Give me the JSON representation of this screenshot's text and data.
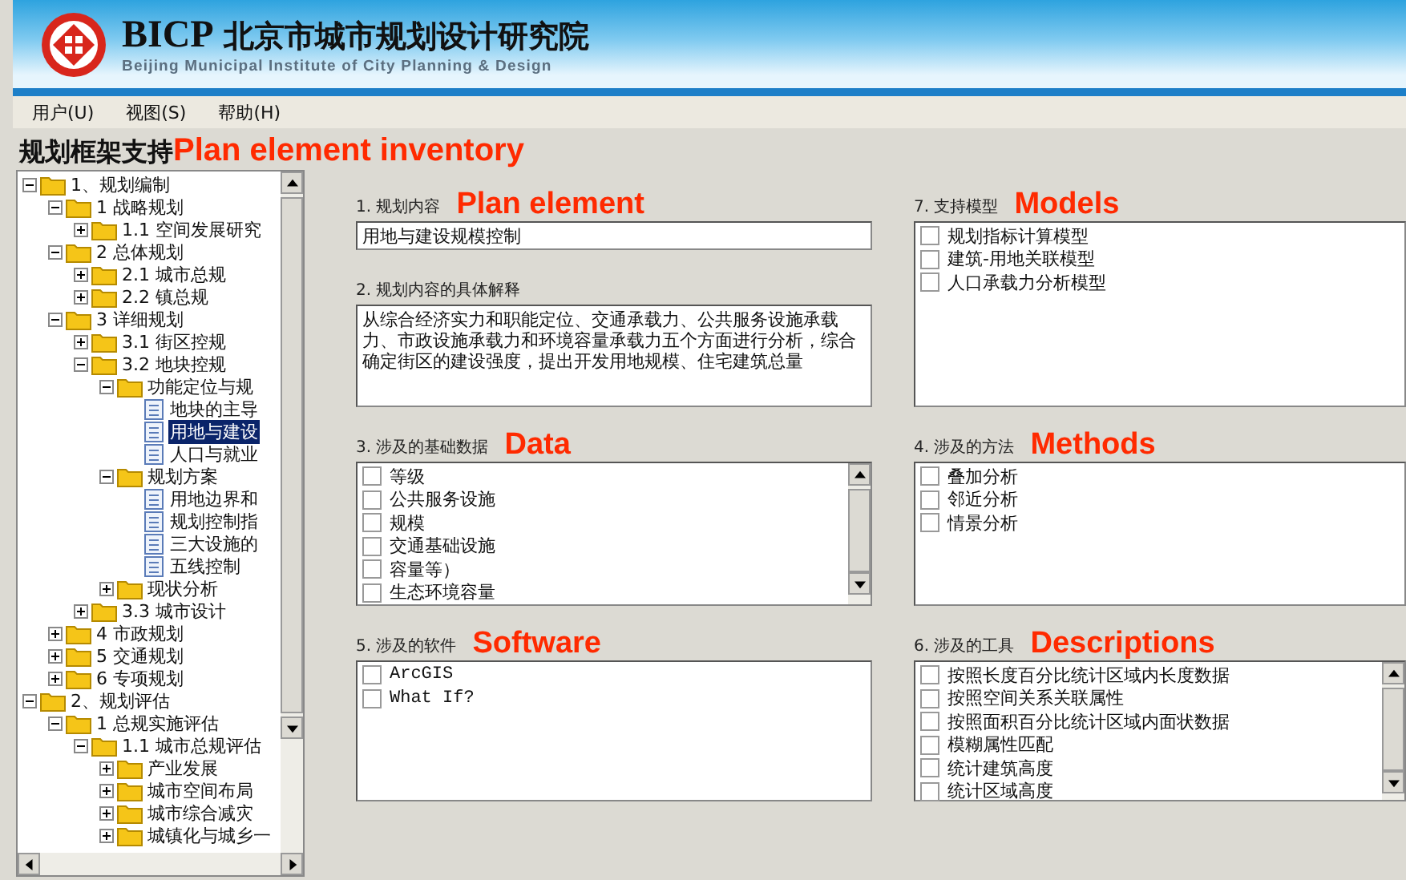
{
  "header": {
    "brand": "BICP",
    "title": "北京市城市规划设计研究院",
    "subtitle": "Beijing Municipal Institute of City Planning & Design"
  },
  "menu": [
    "用户(U)",
    "视图(S)",
    "帮助(H)"
  ],
  "page_title": {
    "text": "规划框架支持",
    "annotation": "Plan element inventory"
  },
  "tree": [
    {
      "label": "1、规划编制",
      "kind": "folder",
      "expanded": true,
      "selected": false,
      "children": [
        {
          "label": "1 战略规划",
          "kind": "folder",
          "expanded": true,
          "selected": false,
          "children": [
            {
              "label": "1.1 空间发展研究",
              "kind": "folder",
              "expanded": false,
              "selected": false
            }
          ]
        },
        {
          "label": "2 总体规划",
          "kind": "folder",
          "expanded": true,
          "selected": false,
          "children": [
            {
              "label": "2.1 城市总规",
              "kind": "folder",
              "expanded": false,
              "selected": false
            },
            {
              "label": "2.2 镇总规",
              "kind": "folder",
              "expanded": false,
              "selected": false
            }
          ]
        },
        {
          "label": "3 详细规划",
          "kind": "folder",
          "expanded": true,
          "selected": false,
          "children": [
            {
              "label": "3.1 街区控规",
              "kind": "folder",
              "expanded": false,
              "selected": false
            },
            {
              "label": "3.2 地块控规",
              "kind": "folder",
              "expanded": true,
              "selected": false,
              "children": [
                {
                  "label": "功能定位与规",
                  "kind": "folder",
                  "expanded": true,
                  "selected": false,
                  "children": [
                    {
                      "label": "地块的主导",
                      "kind": "doc",
                      "selected": false
                    },
                    {
                      "label": "用地与建设",
                      "kind": "doc",
                      "selected": true
                    },
                    {
                      "label": "人口与就业",
                      "kind": "doc",
                      "selected": false
                    }
                  ]
                },
                {
                  "label": "规划方案",
                  "kind": "folder",
                  "expanded": true,
                  "selected": false,
                  "children": [
                    {
                      "label": "用地边界和",
                      "kind": "doc",
                      "selected": false
                    },
                    {
                      "label": "规划控制指",
                      "kind": "doc",
                      "selected": false
                    },
                    {
                      "label": "三大设施的",
                      "kind": "doc",
                      "selected": false
                    },
                    {
                      "label": "五线控制",
                      "kind": "doc",
                      "selected": false
                    }
                  ]
                },
                {
                  "label": "现状分析",
                  "kind": "folder",
                  "expanded": false,
                  "selected": false
                }
              ]
            },
            {
              "label": "3.3 城市设计",
              "kind": "folder",
              "expanded": false,
              "selected": false
            }
          ]
        },
        {
          "label": "4 市政规划",
          "kind": "folder",
          "expanded": false,
          "selected": false
        },
        {
          "label": "5 交通规划",
          "kind": "folder",
          "expanded": false,
          "selected": false
        },
        {
          "label": "6 专项规划",
          "kind": "folder",
          "expanded": false,
          "selected": false
        }
      ]
    },
    {
      "label": "2、规划评估",
      "kind": "folder",
      "expanded": true,
      "selected": false,
      "children": [
        {
          "label": "1 总规实施评估",
          "kind": "folder",
          "expanded": true,
          "selected": false,
          "children": [
            {
              "label": "1.1 城市总规评估",
              "kind": "folder",
              "expanded": true,
              "selected": false,
              "children": [
                {
                  "label": "产业发展",
                  "kind": "folder",
                  "expanded": false,
                  "selected": false
                },
                {
                  "label": "城市空间布局",
                  "kind": "folder",
                  "expanded": false,
                  "selected": false
                },
                {
                  "label": "城市综合减灾",
                  "kind": "folder",
                  "expanded": false,
                  "selected": false
                },
                {
                  "label": "城镇化与城乡一",
                  "kind": "folder",
                  "expanded": false,
                  "selected": false
                }
              ]
            }
          ]
        }
      ]
    }
  ],
  "rows": [
    {
      "left": [
        {
          "label": "1. 规划内容",
          "annotation": "Plan element",
          "kind": "field",
          "value": "用地与建设规模控制"
        },
        {
          "label": "2. 规划内容的具体解释",
          "kind": "textarea",
          "value": "从综合经济实力和职能定位、交通承载力、公共服务设施承载力、市政设施承载力和环境容量承载力五个方面进行分析，综合确定街区的建设强度，提出开发用地规模、住宅建筑总量"
        }
      ],
      "right": [
        {
          "label": "7. 支持模型",
          "annotation": "Models",
          "kind": "list",
          "scrollable": false,
          "items": [
            {
              "label": "规划指标计算模型",
              "checked": false
            },
            {
              "label": "建筑-用地关联模型",
              "checked": false
            },
            {
              "label": "人口承载力分析模型",
              "checked": false
            }
          ]
        }
      ]
    },
    {
      "left": [
        {
          "label": "3. 涉及的基础数据",
          "annotation": "Data",
          "kind": "list",
          "scrollable": true,
          "items": [
            {
              "label": "等级",
              "checked": false
            },
            {
              "label": "公共服务设施",
              "checked": false
            },
            {
              "label": "规模",
              "checked": false
            },
            {
              "label": "交通基础设施",
              "checked": false
            },
            {
              "label": "容量等）",
              "checked": false
            },
            {
              "label": "生态环境容量",
              "checked": false
            }
          ]
        }
      ],
      "right": [
        {
          "label": "4. 涉及的方法",
          "annotation": "Methods",
          "kind": "list",
          "scrollable": false,
          "items": [
            {
              "label": "叠加分析",
              "checked": false
            },
            {
              "label": "邻近分析",
              "checked": false
            },
            {
              "label": "情景分析",
              "checked": false
            }
          ]
        }
      ]
    },
    {
      "left": [
        {
          "label": "5. 涉及的软件",
          "annotation": "Software",
          "kind": "list",
          "scrollable": false,
          "items": [
            {
              "label": "ArcGIS",
              "checked": false
            },
            {
              "label": "What If?",
              "checked": false
            }
          ]
        }
      ],
      "right": [
        {
          "label": "6. 涉及的工具",
          "annotation": "Descriptions",
          "kind": "list",
          "scrollable": true,
          "items": [
            {
              "label": "按照长度百分比统计区域内长度数据",
              "checked": false
            },
            {
              "label": "按照空间关系关联属性",
              "checked": false
            },
            {
              "label": "按照面积百分比统计区域内面状数据",
              "checked": false
            },
            {
              "label": "模糊属性匹配",
              "checked": false
            },
            {
              "label": "统计建筑高度",
              "checked": false
            },
            {
              "label": "统计区域高度",
              "checked": false
            }
          ]
        }
      ]
    }
  ]
}
